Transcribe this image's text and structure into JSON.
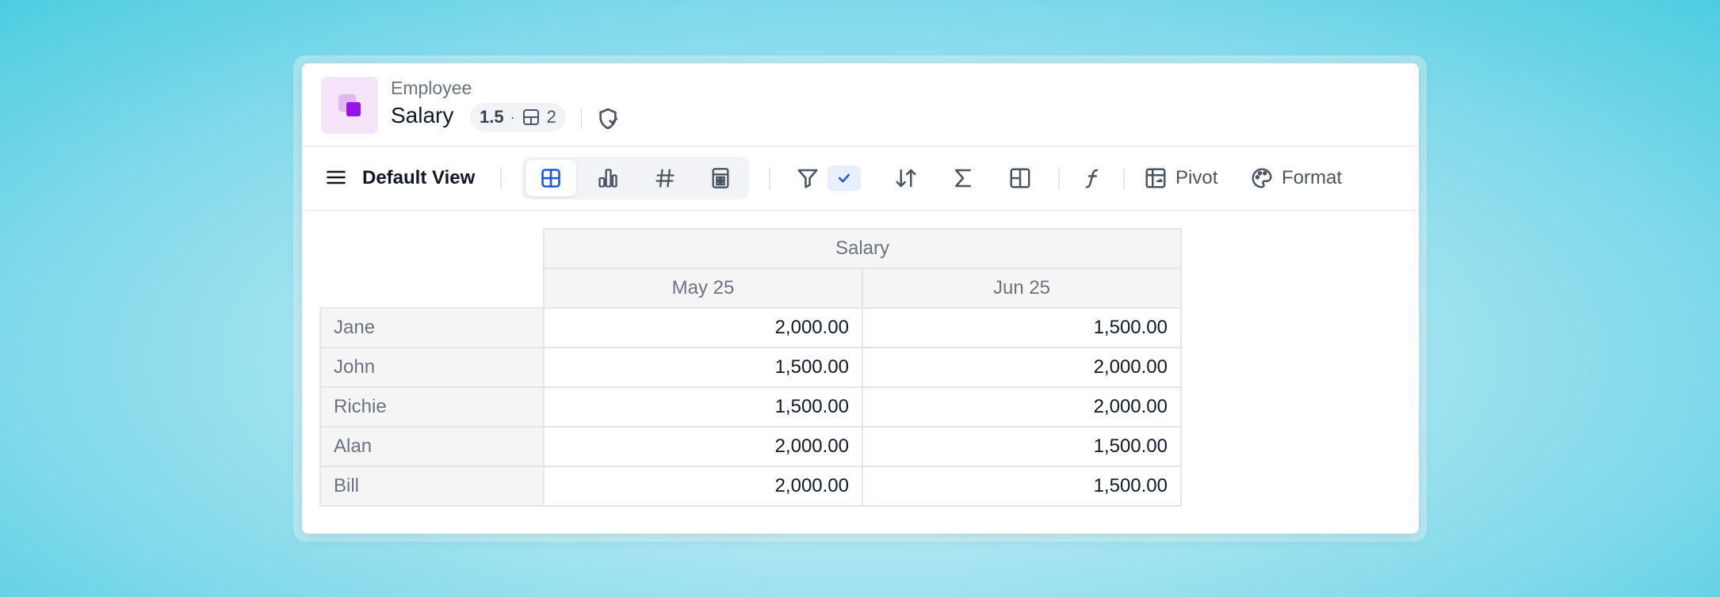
{
  "header": {
    "parent": "Employee",
    "title": "Salary",
    "version": "1.5",
    "separator_dot": "·",
    "layout_count": "2"
  },
  "toolbar": {
    "view_label": "Default View",
    "pivot_label": "Pivot",
    "format_label": "Format",
    "active_view_mode": "table",
    "filter_applied": true
  },
  "icons": {
    "menu": "hamburger-icon",
    "table": "table-grid-icon",
    "chart": "bar-chart-icon",
    "number": "hash-icon",
    "calc": "calculator-icon",
    "filter": "filter-icon",
    "check": "check-icon",
    "sort": "sort-icon",
    "aggregate": "sigma-icon",
    "layout": "layout-icon",
    "formula": "function-icon",
    "pivot": "pivot-icon",
    "format": "palette-icon",
    "shield": "shield-check-icon"
  },
  "colors": {
    "accent": "#1a56db",
    "brand_purple": "#9315e8",
    "brand_light": "#f5e4fa"
  },
  "table": {
    "group_header": "Salary",
    "columns": [
      "May 25",
      "Jun 25"
    ],
    "rows": [
      {
        "name": "Jane",
        "values": [
          "2,000.00",
          "1,500.00"
        ]
      },
      {
        "name": "John",
        "values": [
          "1,500.00",
          "2,000.00"
        ]
      },
      {
        "name": "Richie",
        "values": [
          "1,500.00",
          "2,000.00"
        ]
      },
      {
        "name": "Alan",
        "values": [
          "2,000.00",
          "1,500.00"
        ]
      },
      {
        "name": "Bill",
        "values": [
          "2,000.00",
          "1,500.00"
        ]
      }
    ]
  }
}
